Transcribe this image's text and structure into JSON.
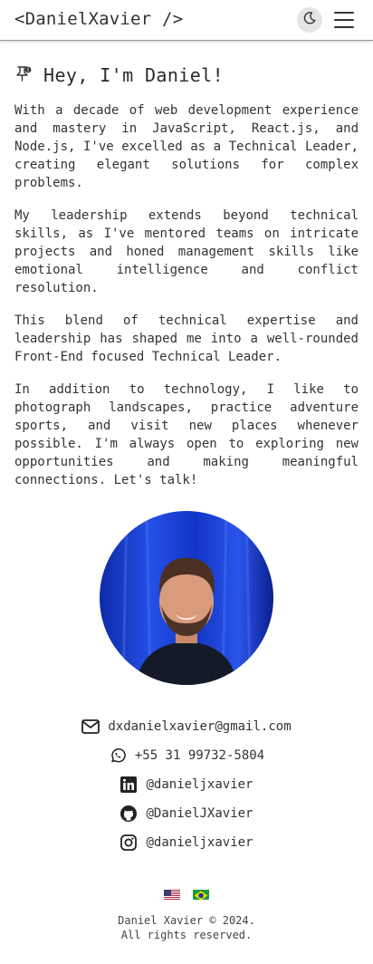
{
  "header": {
    "logo_text": "<DanielXavier />",
    "theme_toggle_icon": "moon-icon",
    "menu_icon": "hamburger-icon"
  },
  "intro": {
    "icon": "pin-alert-icon",
    "heading": "Hey, I'm Daniel!",
    "paragraphs": [
      "With a decade of web development experience and mastery in JavaScript, React.js, and Node.js, I've excelled as a Technical Leader, creating elegant solutions for complex problems.",
      "My leadership extends beyond technical skills, as I've mentored teams on intricate projects and honed management skills like emotional intelligence and conflict resolution.",
      "This blend of technical expertise and leadership has shaped me into a well-rounded Front-End focused Technical Leader.",
      "In addition to technology, I like to photograph landscapes, practice adventure sports, and visit new places whenever possible. I'm always open to exploring new opportunities and making meaningful connections. Let's talk!"
    ]
  },
  "photo": {
    "subject": "portrait-photo",
    "background_color": "#1c3fd6"
  },
  "contacts": [
    {
      "icon": "envelope-icon",
      "text": "dxdanielxavier@gmail.com"
    },
    {
      "icon": "whatsapp-icon",
      "text": "+55 31 99732-5804"
    },
    {
      "icon": "linkedin-icon",
      "text": "@danieljxavier"
    },
    {
      "icon": "github-icon",
      "text": "@DanielJXavier"
    },
    {
      "icon": "instagram-icon",
      "text": "@danieljxavier"
    }
  ],
  "languages": [
    {
      "icon": "us-flag-icon"
    },
    {
      "icon": "brazil-flag-icon"
    }
  ],
  "footer": {
    "line1": "Daniel Xavier © 2024.",
    "line2": "All rights reserved."
  }
}
